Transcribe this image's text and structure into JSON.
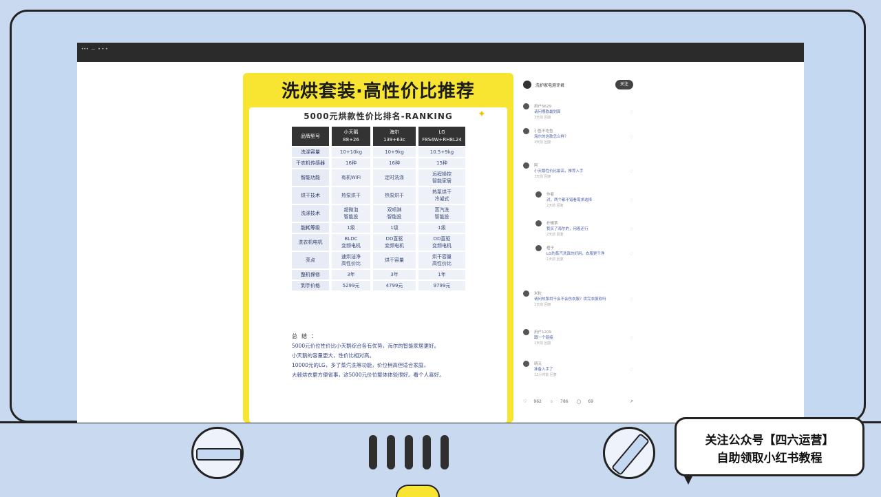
{
  "post": {
    "title": "洗烘套装·高性价比推荐",
    "ranking_title": "5000元烘款性价比排名-RANKING",
    "table": {
      "headers": [
        "品牌型号",
        "小天鹅\n88+26",
        "海尔\n139+63c",
        "LG\nF8S4W+RH8L24"
      ],
      "rows": [
        [
          "洗涤容量",
          "10+10kg",
          "10+9kg",
          "10.5+9kg"
        ],
        [
          "干衣机传感器",
          "16种",
          "16种",
          "15种"
        ],
        [
          "智能功能",
          "有机WiFi",
          "定时洗涤",
          "远程操控\n智能家居"
        ],
        [
          "烘干技术",
          "热泵烘干",
          "热泵烘干",
          "热泵烘干\n冷凝式"
        ],
        [
          "洗涤技术",
          "超微泡\n智能投",
          "双喷淋\n智能投",
          "蒸汽洗\n智能投"
        ],
        [
          "能耗等级",
          "1级",
          "1级",
          "1级"
        ],
        [
          "洗衣机电机",
          "BLDC\n变频电机",
          "DD直驱\n变频电机",
          "DD直驱\n变频电机"
        ],
        [
          "亮点",
          "速烘洁净\n高性价比",
          "烘干容量",
          "烘干容量\n高性价比"
        ],
        [
          "整机保修",
          "3年",
          "3年",
          "1年"
        ],
        [
          "到手价格",
          "5299元",
          "4799元",
          "9799元"
        ]
      ]
    },
    "summary": {
      "heading": "总结：",
      "lines": [
        "5000元价位性价比小天鹅综合各有优势，海尔的智能家居更好。",
        "小天鹅的容量更大，性价比相对高。",
        "10000元的LG，多了蒸汽洗等功能，价位稍高但适合家庭，",
        "大毂烘衣更方便省事，这5000元价位整体体验很好。看个人喜好。"
      ]
    }
  },
  "comments_panel": {
    "author": "洗护家电测评君",
    "follow_label": "关注",
    "comments": [
      {
        "name": "用户5629",
        "text": "请问哪款最划算",
        "meta": "3天前  回复"
      },
      {
        "name": "小鱼不吃鱼",
        "text": "海尔的这款怎么样？",
        "meta": "3天前  回复"
      },
      {
        "name": "阿",
        "text": "小天鹅性价比最高，推荐入手",
        "meta": "3天前  回复"
      },
      {
        "name": "作者",
        "text": "对，两个都不错看需求选择",
        "meta": "2天前  回复"
      },
      {
        "name": "柠檬茶",
        "text": "我买了海尔的，用着还行",
        "meta": "2天前  回复"
      },
      {
        "name": "橙子",
        "text": "LG的蒸汽洗真的好用，衣服更干净",
        "meta": "1天前  回复"
      },
      {
        "name": "米粒",
        "text": "请问热泵烘干会不会伤衣服？烘完衣服软吗",
        "meta": "1天前  回复"
      },
      {
        "name": "用户1209",
        "text": "蹲一个链接",
        "meta": "1天前  回复"
      },
      {
        "name": "晴天",
        "text": "准备入手了",
        "meta": "12小时前  回复"
      }
    ],
    "actions": {
      "likes": "962",
      "stars": "786",
      "comments": "69"
    }
  },
  "bubble": {
    "line1": "关注公众号【四六运营】",
    "line2": "自助领取小红书教程"
  },
  "colors": {
    "frame_blue": "#c5d8f2",
    "card_yellow": "#f7e531",
    "outline": "#222222"
  }
}
